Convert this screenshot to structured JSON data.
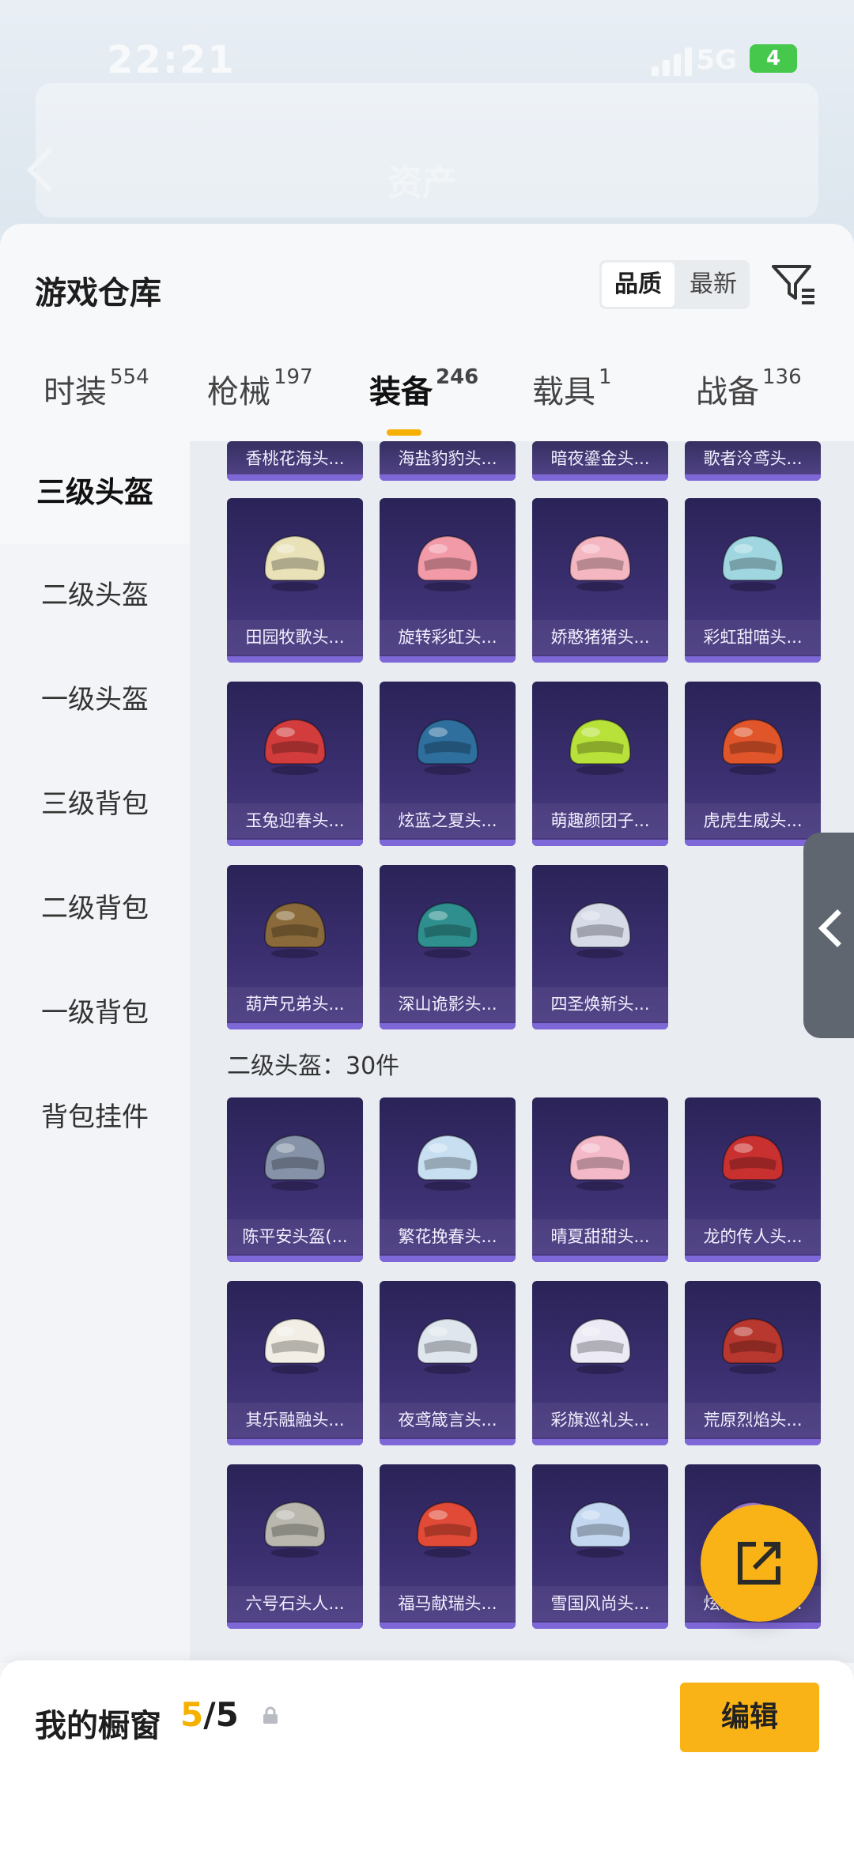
{
  "status_bar": {
    "time": "22:21",
    "network": "5G",
    "battery": "4"
  },
  "background_header": {
    "title": "资产"
  },
  "sheet": {
    "title": "游戏仓库",
    "sort_options": [
      "品质",
      "最新"
    ],
    "tabs": [
      {
        "label": "时装",
        "count": "554"
      },
      {
        "label": "枪械",
        "count": "197"
      },
      {
        "label": "装备",
        "count": "246"
      },
      {
        "label": "载具",
        "count": "1"
      },
      {
        "label": "战备",
        "count": "136"
      }
    ]
  },
  "sidebar": {
    "items": [
      "三级头盔",
      "二级头盔",
      "一级头盔",
      "三级背包",
      "二级背包",
      "一级背包",
      "背包挂件"
    ]
  },
  "grid": {
    "top_row": [
      "香桃花海头...",
      "海盐豹豹头...",
      "暗夜鎏金头...",
      "歌者泠鸢头..."
    ],
    "level3_items": [
      {
        "name": "田园牧歌头...",
        "color": "#e9e2b8"
      },
      {
        "name": "旋转彩虹头...",
        "color": "#f29aa8"
      },
      {
        "name": "娇憨猪猪头...",
        "color": "#f4b6c0"
      },
      {
        "name": "彩虹甜喵头...",
        "color": "#9fd6e0"
      },
      {
        "name": "玉兔迎春头...",
        "color": "#d23c3c"
      },
      {
        "name": "炫蓝之夏头...",
        "color": "#2e6f9e"
      },
      {
        "name": "萌趣颜团子...",
        "color": "#b8e23a"
      },
      {
        "name": "虎虎生威头...",
        "color": "#e0552a"
      },
      {
        "name": "葫芦兄弟头...",
        "color": "#8a6a3a"
      },
      {
        "name": "深山诡影头...",
        "color": "#2f8f8f"
      },
      {
        "name": "四圣焕新头...",
        "color": "#d7dbe8"
      }
    ],
    "section_title": "二级头盔：30件",
    "level2_items": [
      {
        "name": "陈平安头盔(...",
        "color": "#8592a8"
      },
      {
        "name": "繁花挽春头...",
        "color": "#c8dff2"
      },
      {
        "name": "晴夏甜甜头...",
        "color": "#f3b9c9"
      },
      {
        "name": "龙的传人头...",
        "color": "#c93030"
      },
      {
        "name": "其乐融融头...",
        "color": "#f2eee6"
      },
      {
        "name": "夜鸢箴言头...",
        "color": "#dfe6ee"
      },
      {
        "name": "彩旗巡礼头...",
        "color": "#eceaf4"
      },
      {
        "name": "荒原烈焰头...",
        "color": "#b8372e"
      },
      {
        "name": "六号石头人...",
        "color": "#b9b7ae"
      },
      {
        "name": "福马献瑞头...",
        "color": "#e04a36"
      },
      {
        "name": "雪国风尚头...",
        "color": "#c3d8f0"
      },
      {
        "name": "炫彩糖果头...",
        "color": "#9a7ad8"
      }
    ]
  },
  "bottom_bar": {
    "title": "我的橱窗",
    "count_current": "5",
    "count_total": "/5",
    "edit_label": "编辑"
  }
}
